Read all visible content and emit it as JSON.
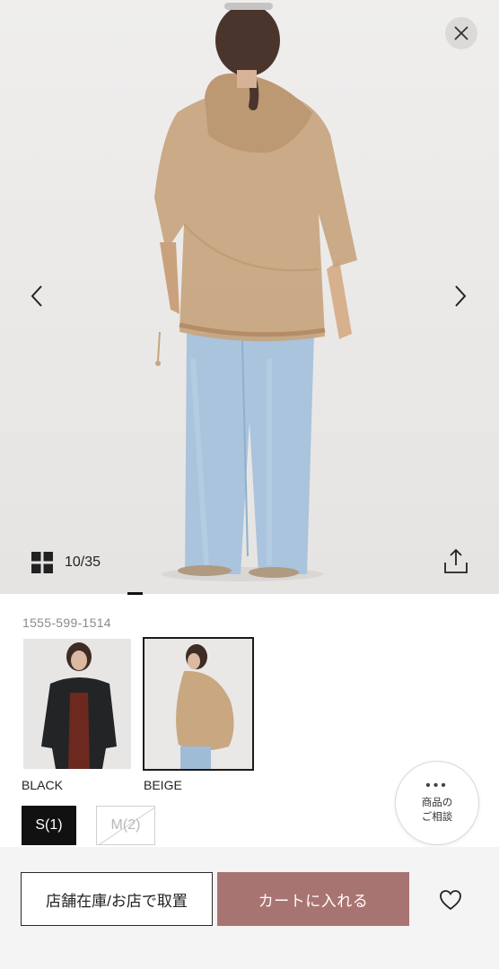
{
  "viewer": {
    "counter": "10/35",
    "icons": {
      "close": "close-icon",
      "prev": "chevron-left-icon",
      "next": "chevron-right-icon",
      "grid": "grid-icon",
      "share": "share-icon"
    },
    "photo": "model-back-view-beige-hooded-jacket-light-blue-jeans"
  },
  "product": {
    "sku": "1555-599-1514",
    "colors": [
      {
        "label": "BLACK",
        "selected": false,
        "photo": "model-front-black-jacket"
      },
      {
        "label": "BEIGE",
        "selected": true,
        "photo": "model-side-beige-jacket"
      }
    ],
    "sizes": [
      {
        "label": "S(1)",
        "selected": true,
        "available": true
      },
      {
        "label": "M(2)",
        "selected": false,
        "available": false
      }
    ],
    "consult": {
      "line1": "商品の",
      "line2": "ご相談",
      "dots": "•••"
    }
  },
  "actions": {
    "store_label": "店舗在庫/お店で取置",
    "cart_label": "カートに入れる",
    "favorite_icon": "heart-icon"
  },
  "colors": {
    "cart_button": "#a87472",
    "viewer_bg": "#edebea",
    "selected_size_bg": "#111111"
  }
}
